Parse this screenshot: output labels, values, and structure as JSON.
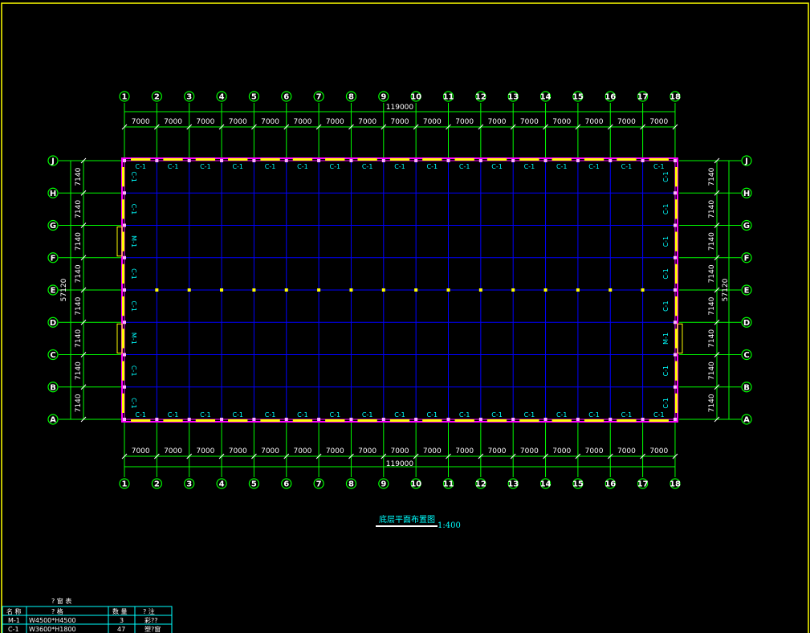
{
  "drawing": {
    "title": "底层平面布置图",
    "scale": "1:400",
    "total_x": "119000",
    "total_y": "57120",
    "bay_x": "7000",
    "bay_y": "7140"
  },
  "axes_x": [
    "1",
    "2",
    "3",
    "4",
    "5",
    "6",
    "7",
    "8",
    "9",
    "10",
    "11",
    "12",
    "13",
    "14",
    "15",
    "16",
    "17",
    "18"
  ],
  "axes_y": [
    "J",
    "H",
    "G",
    "F",
    "E",
    "D",
    "C",
    "B",
    "A"
  ],
  "window_tag": "C-1",
  "door_tag": "M-1",
  "schedule": {
    "title": "? 窗 表",
    "headers": [
      "名 称",
      "? 格",
      "数 量",
      "? 注"
    ],
    "rows": [
      [
        "M-1",
        "W4500*H4500",
        "3",
        "彩??"
      ],
      [
        "C-1",
        "W3600*H1800",
        "47",
        "塑?窗"
      ]
    ]
  },
  "colors": {
    "grid_lines": "#00ff00",
    "bays": "#0000ff",
    "wall": "#ff00ff",
    "wall_fill": "#ffff00",
    "text_cyan": "#00ffff",
    "frame": "#ffff00"
  }
}
